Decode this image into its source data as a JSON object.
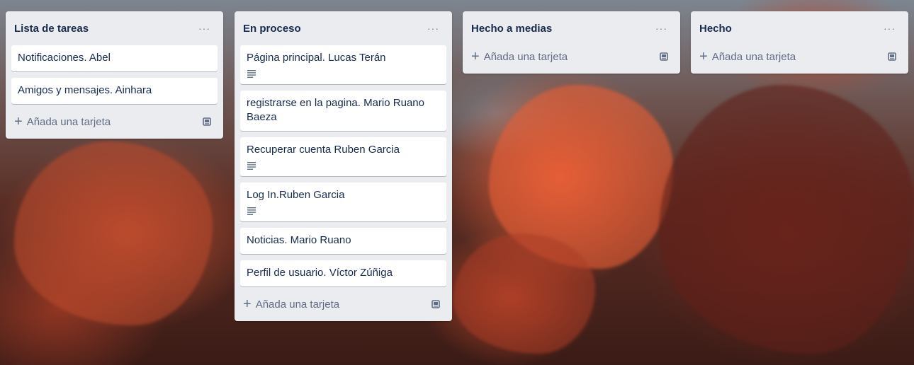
{
  "lists": [
    {
      "title": "Lista de tareas",
      "menu": "···",
      "cards": [
        {
          "text": "Notificaciones. Abel",
          "has_description": false
        },
        {
          "text": "Amigos y mensajes. Ainhara",
          "has_description": false
        }
      ],
      "add_label": "Añada una tarjeta"
    },
    {
      "title": "En proceso",
      "menu": "···",
      "cards": [
        {
          "text": "Página principal. Lucas Terán",
          "has_description": true
        },
        {
          "text": "registrarse en la pagina. Mario Ruano Baeza",
          "has_description": false
        },
        {
          "text": "Recuperar cuenta Ruben Garcia",
          "has_description": true
        },
        {
          "text": "Log In.Ruben Garcia",
          "has_description": true
        },
        {
          "text": "Noticias. Mario Ruano",
          "has_description": false
        },
        {
          "text": "Perfil de usuario. Víctor Zúñiga",
          "has_description": false
        }
      ],
      "add_label": "Añada una tarjeta"
    },
    {
      "title": "Hecho a medias",
      "menu": "···",
      "cards": [],
      "add_label": "Añada una tarjeta"
    },
    {
      "title": "Hecho",
      "menu": "···",
      "cards": [],
      "add_label": "Añada una tarjeta"
    }
  ],
  "icons": {
    "plus": "+",
    "description": "description-icon",
    "template": "card-template-icon",
    "more": "more-dots-icon"
  },
  "colors": {
    "list_bg": "#ebecf0",
    "card_bg": "#ffffff",
    "text": "#172b4d",
    "muted": "#5e6c84"
  }
}
